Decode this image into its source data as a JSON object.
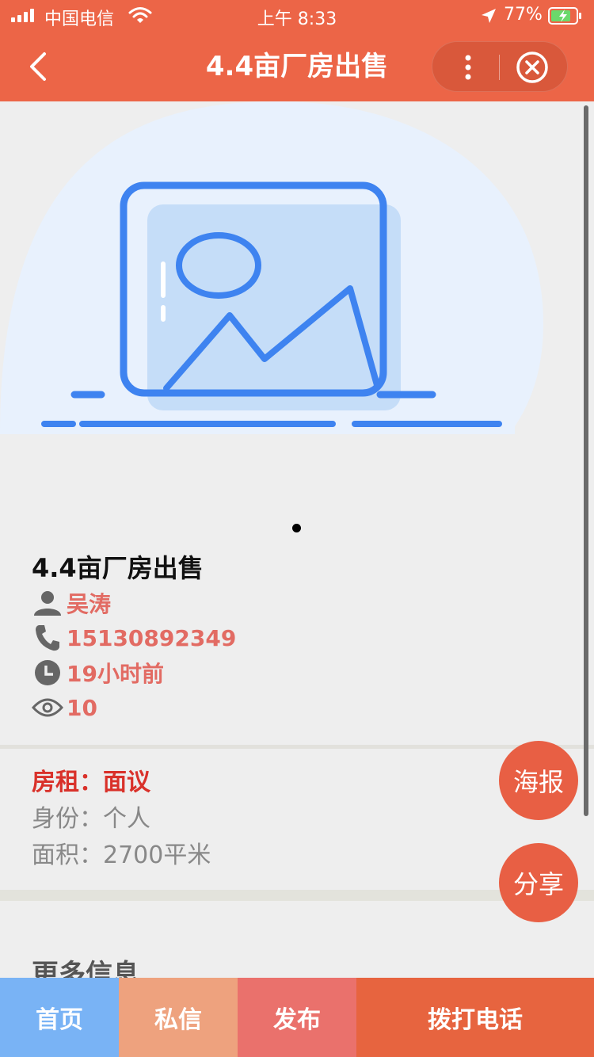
{
  "status_bar": {
    "carrier": "中国电信",
    "time": "上午 8:33",
    "battery": "77%"
  },
  "nav": {
    "title": "4.4亩厂房出售"
  },
  "listing": {
    "title": "4.4亩厂房出售",
    "contact_name": "吴涛",
    "phone": "15130892349",
    "posted": "19小时前",
    "views": "10"
  },
  "details": {
    "rent_label": "房租：",
    "rent_value": "面议",
    "identity_label": "身份：",
    "identity_value": "个人",
    "area_label": "面积：",
    "area_value": "2700平米"
  },
  "more_info_heading": "更多信息",
  "fabs": {
    "poster": "海报",
    "share": "分享"
  },
  "tabbar": {
    "home": "首页",
    "message": "私信",
    "publish": "发布",
    "call": "拨打电话"
  },
  "colors": {
    "brand": "#ec6547",
    "accent_text": "#e26b63",
    "rent": "#d9312a"
  },
  "icons": {
    "user": "person-icon",
    "phone": "phone-icon",
    "time": "clock-icon",
    "views": "eye-icon",
    "placeholder": "image-placeholder-icon"
  }
}
